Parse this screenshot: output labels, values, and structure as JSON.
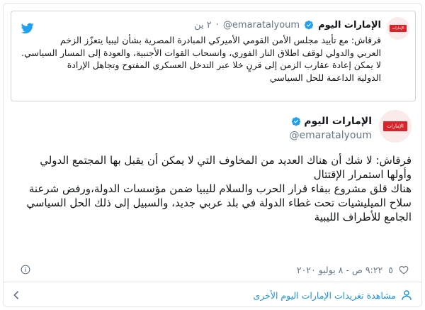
{
  "quoted": {
    "name": "الإمارات اليوم",
    "handle": "@emaratalyoum",
    "separator": "·",
    "time": "٢ ين",
    "logo_text": "الإمارات اليوم",
    "lines": [
      "قرقاش: مع تأييد مجلس الأمن القومي الأميركي المبادرة المصرية بشأن ليبيا يتعزّز الزخم",
      "العربي والدولي لوقف اطلاق النار الفوري، وانسحاب القوات الأجنبية، والعودة إلى المسار السياسي.",
      "لا يمكن إعادة عقارب الزمن إلى قرنٍ خلا عبر التدخل العسكري المفتوح وتجاهل الإرادة",
      "الدولية الداعمة للحل السياسي"
    ]
  },
  "tweet": {
    "name": "الإمارات اليوم",
    "handle": "@emaratalyoum",
    "logo_text": "الإمارات اليوم",
    "paragraph1": [
      "قرقاش: لا شك أن هناك العديد من المخاوف التي لا يمكن أن يقبل بها المجتمع الدولي",
      "وأولها استمرار الإقتتال"
    ],
    "paragraph2": [
      "هناك قلق مشروع ببقاء قرار الحرب والسلام لليبيا ضمن مؤسسات الدولة،ورفض شرعنة",
      "سلاح الميليشيات تحت غطاء الدولة في بلد عربي جديد، والسبيل إلى ذلك الحل السياسي",
      "الجامع للأطراف الليبية"
    ],
    "likes": "٥",
    "timestamp": "٩:٢٢ ص - ٨ يوليو ٢٠٢٠"
  },
  "footer": {
    "more_label": "مشاهدة تغريدات الإمارات اليوم الأخرى"
  },
  "colors": {
    "twitter_blue": "#1da1f2",
    "link_blue": "#1b95e0",
    "brand_red": "#d9232a",
    "muted": "#657786"
  },
  "icons": [
    "twitter-bird-icon",
    "verified-badge-icon",
    "heart-icon",
    "info-icon",
    "person-icon",
    "chevron-left-icon"
  ]
}
